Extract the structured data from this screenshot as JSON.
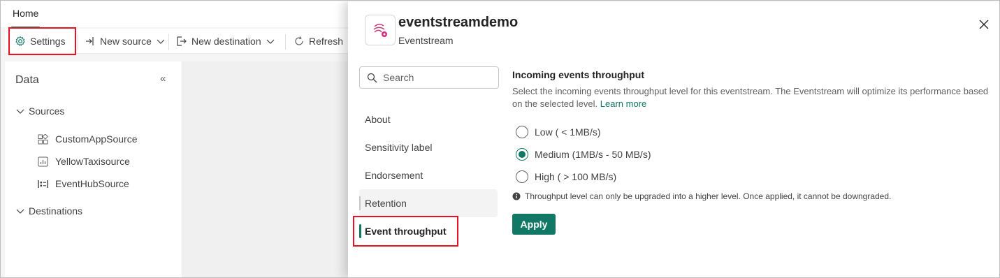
{
  "tabbar": {
    "home_label": "Home"
  },
  "toolbar": {
    "settings_label": "Settings",
    "new_source_label": "New source",
    "new_destination_label": "New destination",
    "refresh_label": "Refresh"
  },
  "data_panel": {
    "title": "Data",
    "sources_label": "Sources",
    "sources": [
      {
        "label": "CustomAppSource",
        "icon": "app-grid-icon"
      },
      {
        "label": "YellowTaxisource",
        "icon": "chart-icon"
      },
      {
        "label": "EventHubSource",
        "icon": "event-hub-icon"
      }
    ],
    "destinations_label": "Destinations"
  },
  "dialog": {
    "title": "eventstreamdemo",
    "subtitle": "Eventstream",
    "search_placeholder": "Search",
    "nav": [
      "About",
      "Sensitivity label",
      "Endorsement",
      "Retention",
      "Event throughput"
    ],
    "section_title": "Incoming events throughput",
    "section_desc": "Select the incoming events throughput level for this eventstream. The Eventstream will optimize its performance based on the selected level.",
    "learn_more": "Learn more",
    "options": [
      {
        "label": "Low ( < 1MB/s)",
        "checked": false
      },
      {
        "label": "Medium (1MB/s - 50 MB/s)",
        "checked": true
      },
      {
        "label": "High ( > 100 MB/s)",
        "checked": false
      }
    ],
    "note": "Throughput level can only be upgraded into a higher level. Once applied, it cannot be downgraded.",
    "apply_label": "Apply"
  },
  "colors": {
    "accent": "#117865",
    "highlight": "#e81123"
  }
}
